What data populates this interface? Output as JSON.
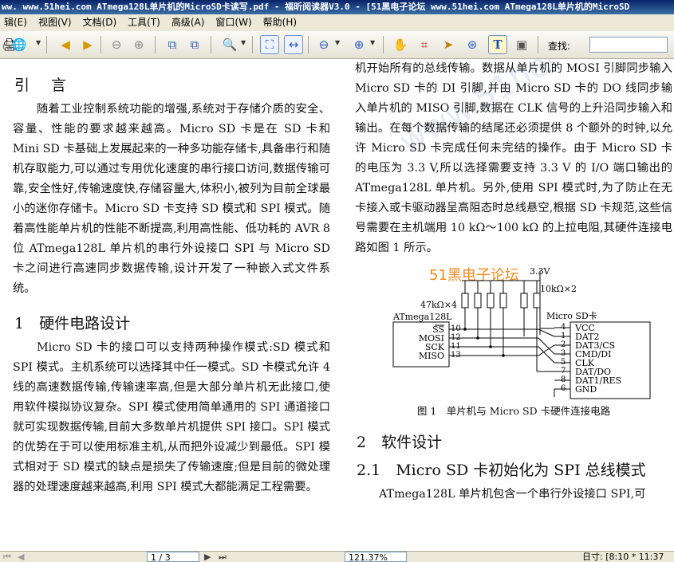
{
  "window": {
    "title": "ww. www.51hei.com ATmega128L单片机的MicroSD卡读写.pdf - 福昕阅读器V3.0 - [51黑电子论坛 www.51hei.com ATmega128L单片机的MicroSD"
  },
  "menu": [
    "辑(E)",
    "视图(V)",
    "文档(D)",
    "工具(T)",
    "高级(A)",
    "窗口(W)",
    "帮助(H)"
  ],
  "toolbar": {
    "find_label": "查找:",
    "find_value": ""
  },
  "doc": {
    "watermark": "www.51hei",
    "left": [
      {
        "type": "heading1",
        "text": "引　言"
      },
      {
        "type": "para",
        "text": "随着工业控制系统功能的增强,系统对于存储介质的安全、容量、性能的要求越来越高。Micro SD 卡是在 SD 卡和 Mini SD 卡基础上发展起来的一种多功能存储卡,具备串行和随机存取能力,可以通过专用优化速度的串行接口访问,数据传输可靠,安全性好,传输速度快,存储容量大,体积小,被列为目前全球最小的迷你存储卡。Micro SD 卡支持 SD 模式和 SPI 模式。随着高性能单片机的性能不断提高,利用高性能、低功耗的 AVR 8 位 ATmega128L 单片机的串行外设接口 SPI 与 Micro SD 卡之间进行高速同步数据传输,设计开发了一种嵌入式文件系统。"
      },
      {
        "type": "heading2",
        "text": "1　硬件电路设计"
      },
      {
        "type": "para",
        "text": "Micro SD 卡的接口可以支持两种操作模式:SD 模式和 SPI 模式。主机系统可以选择其中任一模式。SD 卡模式允许 4 线的高速数据传输,传输速率高,但是大部分单片机无此接口,使用软件模拟协议复杂。SPI 模式使用简单通用的 SPI 通道接口就可实现数据传输,目前大多数单片机提供 SPI 接口。SPI 模式的优势在于可以使用标准主机,从而把外设减少到最低。SPI 模式相对于 SD 模式的缺点是损失了传输速度;但是目前的微处理器的处理速度越来越高,利用 SPI 模式大都能满足工程需要。"
      }
    ],
    "right_top_para": "机开始所有的总线传输。数据从单片机的 MOSI 引脚同步输入 Micro SD 卡的 DI 引脚,并由 Micro SD 卡的 DO 线同步输入单片机的 MISO 引脚,数据在 CLK 信号的上升沿同步输入和输出。在每个数据传输的结尾还必须提供 8 个额外的时钟,以允许 Micro SD 卡完成任何未完结的操作。由于 Micro SD 卡的电压为 3.3 V,所以选择需要支持 3.3 V 的 I/O 端口输出的 ATmega128L 单片机。另外,使用 SPI 模式时,为了防止在无卡接入或卡驱动器呈高阻态时总线悬空,根据 SD 卡规范,这些信号需要在主机端用 10 kΩ～100 kΩ 的上拉电阻,其硬件连接电路如图 1 所示。",
    "figure": {
      "stamp": "51黑电子论坛",
      "vcc": "3.3V",
      "r_right": "10kΩ×2",
      "r_left": "47kΩ×4",
      "mcu": "ATmega128L",
      "mcu_pins": [
        "SS",
        "MOSI",
        "SCK",
        "MISO"
      ],
      "pin_numbers": [
        "10",
        "12",
        "11",
        "13"
      ],
      "card": "Micro SD卡",
      "card_pins": [
        "VCC",
        "DAT2",
        "DAT3/CS",
        "CMD/DI",
        "CLK",
        "DAT/DO",
        "DAT1/RES",
        "GND"
      ],
      "card_numbers": [
        "4",
        "1",
        "2",
        "3",
        "5",
        "7",
        "8",
        "6"
      ],
      "caption": "图 1　单片机与 Micro SD 卡硬件连接电路"
    },
    "heading2_b": "2　软件设计",
    "heading2_c": "2.1　Micro SD 卡初始化为 SPI 总线模式",
    "right_bottom_para": "ATmega128L 单片机包含一个串行外设接口 SPI,可"
  },
  "status": {
    "page": "1 / 3",
    "zoom": "121.37%",
    "time": "日寸: [8:10 * 11:37"
  }
}
